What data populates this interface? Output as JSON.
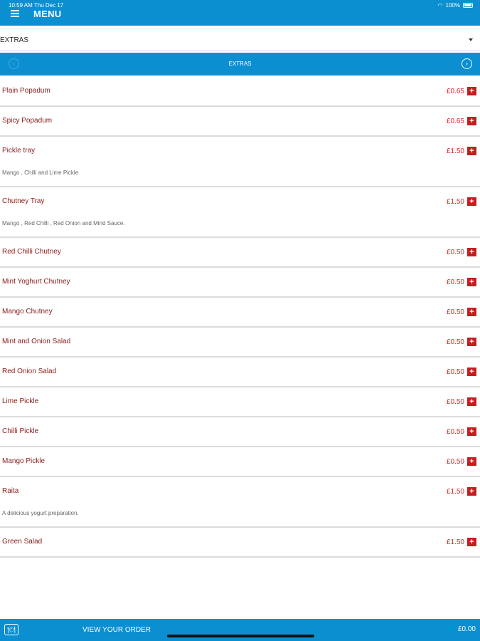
{
  "status_bar": {
    "time": "10:59 AM  Thu Dec 17",
    "battery": "100%"
  },
  "header": {
    "title": "MENU"
  },
  "category_select": {
    "value": "EXTRAS"
  },
  "category_bar": {
    "title": "EXTRAS"
  },
  "items": [
    {
      "name": "Plain Popadum",
      "price": "£0.65"
    },
    {
      "name": "Spicy Popadum",
      "price": "£0.65"
    },
    {
      "name": "Pickle tray",
      "price": "£1.50",
      "desc": "Mango , Chilli and Lime Pickle"
    },
    {
      "name": "Chutney Tray",
      "price": "£1.50",
      "desc": "Mango , Red Chilli , Red Onion and Mind Sauce."
    },
    {
      "name": "Red Chilli Chutney",
      "price": "£0.50"
    },
    {
      "name": "Mint Yoghurt Chutney",
      "price": "£0.50"
    },
    {
      "name": "Mango Chutney",
      "price": "£0.50"
    },
    {
      "name": "Mint and Onion Salad",
      "price": "£0.50"
    },
    {
      "name": "Red Onion Salad",
      "price": "£0.50"
    },
    {
      "name": "Lime Pickle",
      "price": "£0.50"
    },
    {
      "name": "Chilli Pickle",
      "price": "£0.50"
    },
    {
      "name": "Mango Pickle",
      "price": "£0.50"
    },
    {
      "name": "Raita",
      "price": "£1.50",
      "desc": "A delicious yogurt preparation."
    },
    {
      "name": "Green Salad",
      "price": "£1.50"
    }
  ],
  "footer": {
    "view_order_label": "VIEW YOUR ORDER",
    "total": "£0.00"
  },
  "colors": {
    "primary_blue": "#0b8fd1",
    "item_name": "#8b1b1b",
    "price_red": "#d32a2a",
    "add_button": "#c41e1e"
  },
  "icons": {
    "menu": "hamburger-icon",
    "prev": "chevron-left-icon",
    "next": "chevron-right-icon",
    "add": "plus-icon",
    "cart": "cart-icon",
    "dropdown": "caret-down-icon"
  }
}
